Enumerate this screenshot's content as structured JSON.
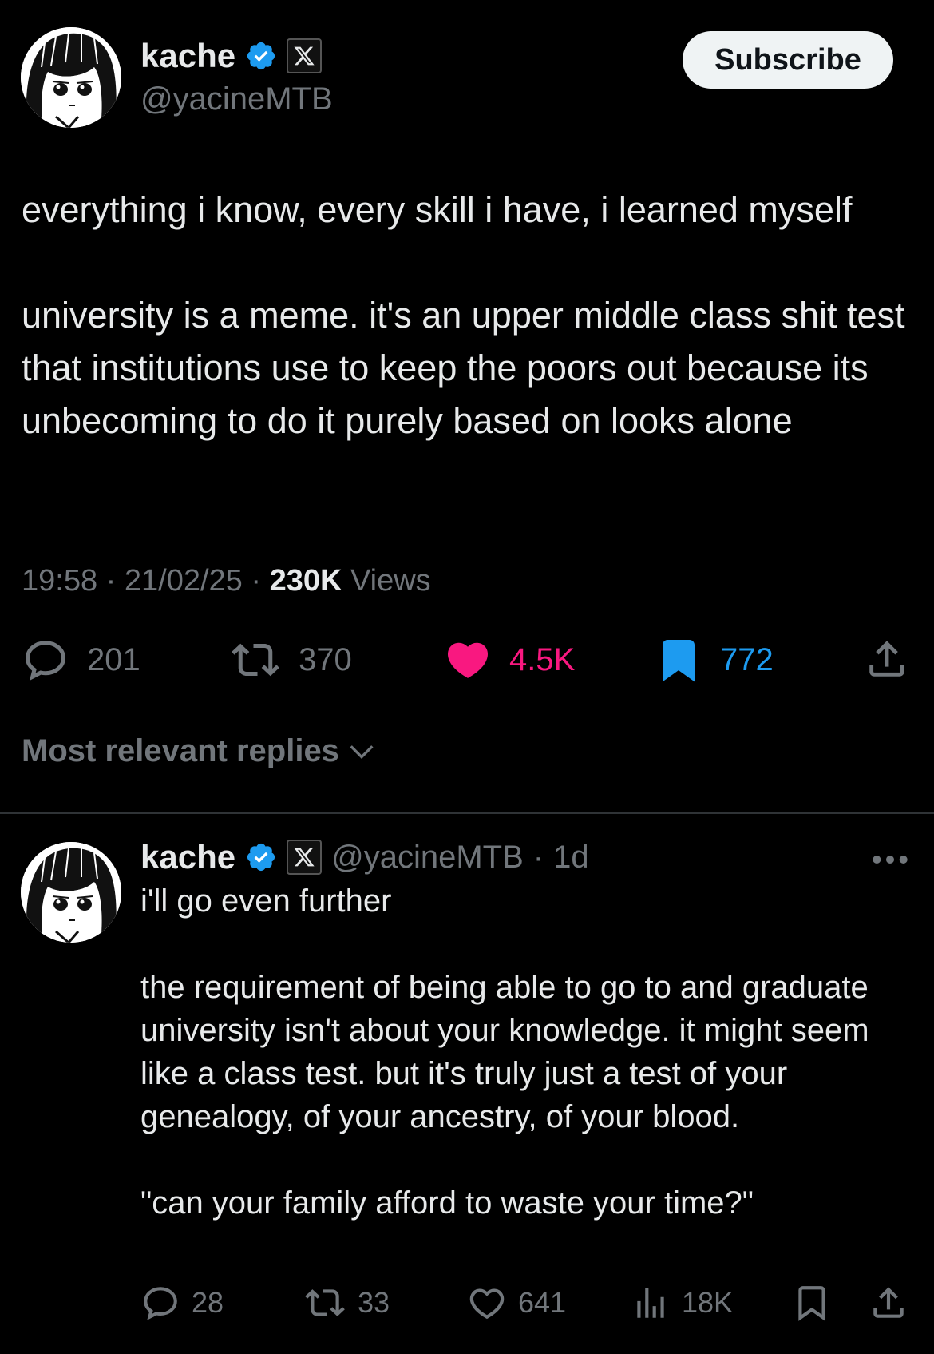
{
  "tweet": {
    "author": {
      "display_name": "kache",
      "handle": "@yacineMTB",
      "verified_icon": "verified-badge-icon",
      "affiliate_icon": "x-logo-icon"
    },
    "subscribe_label": "Subscribe",
    "text": "everything i know, every skill i have, i learned myself\n\nuniversity is a meme. it's an upper middle class shit test that institutions use to keep the poors out because its unbecoming to do it purely based on looks alone",
    "time": "19:58",
    "date": "21/02/25",
    "views_count": "230K",
    "views_label": "Views",
    "separator": "·",
    "stats": {
      "replies": "201",
      "retweets": "370",
      "likes": "4.5K",
      "bookmarks": "772"
    },
    "colors": {
      "like": "#f91880",
      "bookmark": "#1d9bf0",
      "muted": "#71767b"
    }
  },
  "replies_section": {
    "sort_label": "Most relevant replies"
  },
  "reply": {
    "display_name": "kache",
    "handle": "@yacineMTB",
    "age": "1d",
    "separator": "·",
    "text": "i'll go even further\n\nthe requirement of being able to go to and graduate university isn't about your knowledge. it might seem like a class test. but it's truly just a test of your genealogy, of your ancestry, of your blood.\n\n\"can your family afford to waste your time?\"",
    "stats": {
      "replies": "28",
      "retweets": "33",
      "likes": "641",
      "views": "18K"
    }
  }
}
